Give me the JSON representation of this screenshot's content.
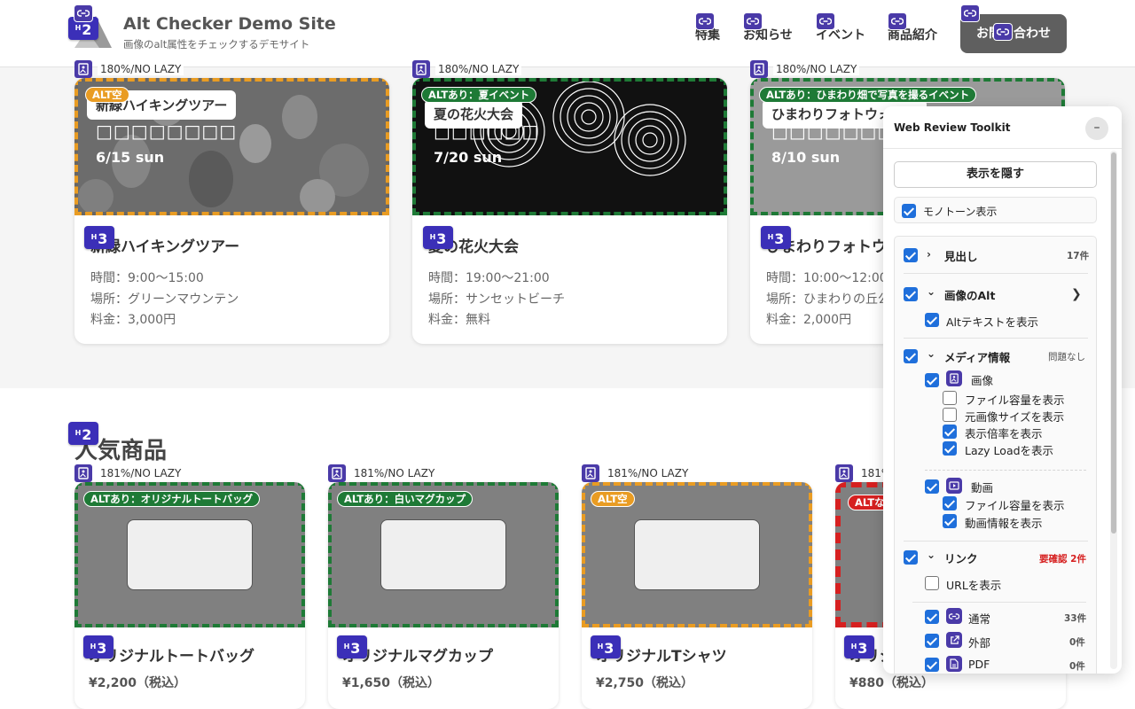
{
  "header": {
    "site_title": "Alt Checker Demo Site",
    "site_subtitle": "画像のalt属性をチェックするデモサイト",
    "nav": [
      "特集",
      "お知らせ",
      "イベント",
      "商品紹介"
    ],
    "contact_button": "お問い合わせ"
  },
  "badges": {
    "h2": "2",
    "h3": "3",
    "h_prefix": "H"
  },
  "events": [
    {
      "image_info": "180%/NO LAZY",
      "alt_tag": "ALT空",
      "alt_status": "empty",
      "pill": "新緑ハイキングツアー",
      "blocks": "□□□□□□□□",
      "date": "6/15 sun",
      "title": "新緑ハイキングツアー",
      "lines": [
        "時間：9:00〜15:00",
        "場所：グリーンマウンテン",
        "料金：3,000円"
      ]
    },
    {
      "image_info": "180%/NO LAZY",
      "alt_tag": "ALTあり：夏イベント",
      "alt_status": "ok",
      "pill": "夏の花火大会",
      "blocks": "□□□□□□",
      "date": "7/20 sun",
      "title": "夏の花火大会",
      "lines": [
        "時間：19:00〜21:00",
        "場所：サンセットビーチ",
        "料金：無料"
      ]
    },
    {
      "image_info": "180%/NO LAZY",
      "alt_tag": "ALTあり：ひまわり畑で写真を撮るイベント",
      "alt_status": "ok",
      "pill": "ひまわりフォトウォーク",
      "blocks": "□□□□□□□□□□□",
      "date": "8/10 sun",
      "title": "ひまわりフォトウォーク",
      "lines": [
        "時間：10:00〜12:00",
        "場所：ひまわりの丘公園",
        "料金：2,000円"
      ]
    }
  ],
  "products_section": {
    "title": "人気商品",
    "items": [
      {
        "image_info": "181%/NO LAZY",
        "alt_tag": "ALTあり：オリジナルトートバッグ",
        "alt_status": "ok",
        "title": "オリジナルトートバッグ",
        "price": "¥2,200（税込）"
      },
      {
        "image_info": "181%/NO LAZY",
        "alt_tag": "ALTあり：白いマグカップ",
        "alt_status": "ok",
        "title": "オリジナルマグカップ",
        "price": "¥1,650（税込）"
      },
      {
        "image_info": "181%/NO LAZY",
        "alt_tag": "ALT空",
        "alt_status": "empty",
        "title": "オリジナルTシャツ",
        "price": "¥2,750（税込）"
      },
      {
        "image_info": "181%/NO LAZY",
        "alt_tag": "ALTなし",
        "alt_status": "missing",
        "title": "オリジナルステッカー",
        "price": "¥880（税込）"
      }
    ]
  },
  "panel": {
    "title": "Web Review Toolkit",
    "minimize": "–",
    "hide_button": "表示を隠す",
    "mono": {
      "label": "モノトーン表示",
      "checked": true
    },
    "headings": {
      "label": "見出し",
      "count": "17件",
      "checked": true
    },
    "image_alt": {
      "label": "画像のAlt",
      "checked": true,
      "show_alt_text": "Altテキストを表示"
    },
    "media": {
      "label": "メディア情報",
      "status": "問題なし",
      "image": {
        "label": "画像",
        "options": [
          "ファイル容量を表示",
          "元画像サイズを表示",
          "表示倍率を表示",
          "Lazy Loadを表示"
        ],
        "checked": [
          false,
          false,
          true,
          true
        ]
      },
      "video": {
        "label": "動画",
        "options": [
          "ファイル容量を表示",
          "動画情報を表示"
        ]
      }
    },
    "links": {
      "label": "リンク",
      "status": "要確認 2件",
      "show_url": "URLを表示",
      "types": [
        {
          "label": "通常",
          "count": "33件"
        },
        {
          "label": "外部",
          "count": "0件"
        },
        {
          "label": "PDF",
          "count": "0件"
        }
      ]
    },
    "accent_color": "#1f6fdb",
    "badge_color": "#4a3aa8"
  },
  "colors": {
    "alt_ok": "#1e7a36",
    "alt_empty": "#e99c23",
    "alt_missing": "#d62020"
  }
}
